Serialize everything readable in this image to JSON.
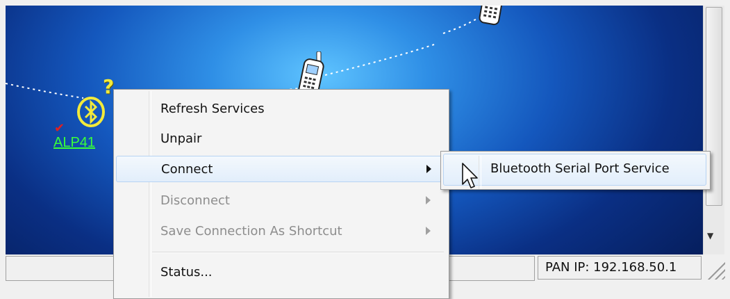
{
  "device": {
    "label": "ALP41",
    "status_icon": "question-mark-icon",
    "paired_icon": "red-check-icon"
  },
  "context_menu": {
    "items": [
      {
        "label": "Refresh Services",
        "enabled": true,
        "submenu": false
      },
      {
        "label": "Unpair",
        "enabled": true,
        "submenu": false
      },
      {
        "label": "Connect",
        "enabled": true,
        "submenu": true,
        "highlighted": true
      },
      {
        "label": "Disconnect",
        "enabled": false,
        "submenu": true
      },
      {
        "label": "Save Connection As Shortcut",
        "enabled": false,
        "submenu": true
      },
      {
        "label": "Status...",
        "enabled": true,
        "submenu": false
      }
    ]
  },
  "submenu": {
    "items": [
      {
        "label": "Bluetooth Serial Port Service",
        "highlighted": true
      }
    ]
  },
  "statusbar": {
    "pan_ip": "PAN IP: 192.168.50.1"
  },
  "colors": {
    "canvas_blue": "#1457bd",
    "device_label_green": "#39ff3a",
    "bluetooth_yellow": "#f2ea3b",
    "menu_highlight": "#e2eefb"
  }
}
